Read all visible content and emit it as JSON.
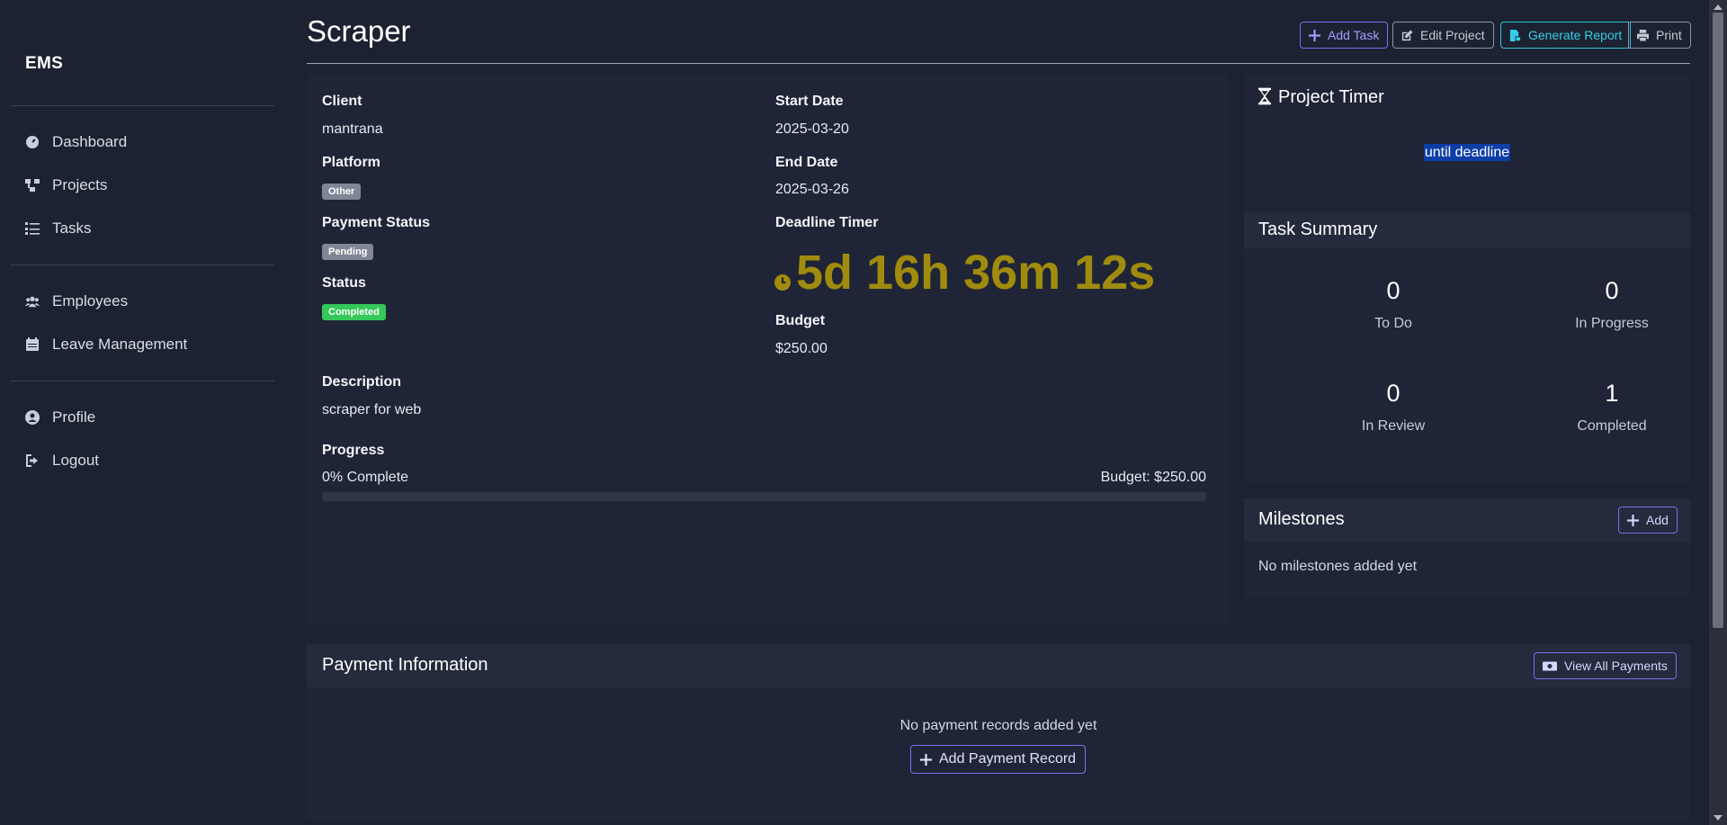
{
  "sidebar": {
    "brand": "EMS",
    "items": [
      {
        "label": "Dashboard",
        "icon": "dashboard-icon"
      },
      {
        "label": "Projects",
        "icon": "projects-icon"
      },
      {
        "label": "Tasks",
        "icon": "tasks-icon"
      },
      {
        "label": "Employees",
        "icon": "employees-icon"
      },
      {
        "label": "Leave Management",
        "icon": "calendar-icon"
      },
      {
        "label": "Profile",
        "icon": "profile-icon"
      },
      {
        "label": "Logout",
        "icon": "logout-icon"
      }
    ]
  },
  "header": {
    "title": "Scraper",
    "buttons": {
      "add_task": "Add Task",
      "edit_project": "Edit Project",
      "generate_report": "Generate Report",
      "print": "Print"
    }
  },
  "details": {
    "client_label": "Client",
    "client_value": "mantrana",
    "platform_label": "Platform",
    "platform_value": "Other",
    "payment_status_label": "Payment Status",
    "payment_status_value": "Pending",
    "status_label": "Status",
    "status_value": "Completed",
    "start_date_label": "Start Date",
    "start_date_value": "2025-03-20",
    "end_date_label": "End Date",
    "end_date_value": "2025-03-26",
    "deadline_timer_label": "Deadline Timer",
    "deadline_timer_value": "5d 16h 36m 12s",
    "budget_label": "Budget",
    "budget_value": "$250.00",
    "description_label": "Description",
    "description_value": "scraper for web",
    "progress_label": "Progress",
    "progress_text": "0% Complete",
    "progress_value": 0,
    "progress_budget": "Budget: $250.00"
  },
  "project_timer": {
    "title": "Project Timer",
    "text": "until deadline"
  },
  "task_summary": {
    "title": "Task Summary",
    "stats": [
      {
        "value": "0",
        "label": "To Do"
      },
      {
        "value": "0",
        "label": "In Progress"
      },
      {
        "value": "0",
        "label": "In Review"
      },
      {
        "value": "1",
        "label": "Completed"
      }
    ]
  },
  "milestones": {
    "title": "Milestones",
    "add_label": "Add",
    "empty": "No milestones added yet"
  },
  "payment": {
    "title": "Payment Information",
    "view_all_label": "View All Payments",
    "empty": "No payment records added yet",
    "add_record_label": "Add Payment Record"
  },
  "colors": {
    "background": "#1c2231",
    "accent_purple": "#7b6cf0",
    "accent_teal": "#2cc3dd",
    "timer_gold": "#a08b0e",
    "status_green": "#34c759"
  }
}
